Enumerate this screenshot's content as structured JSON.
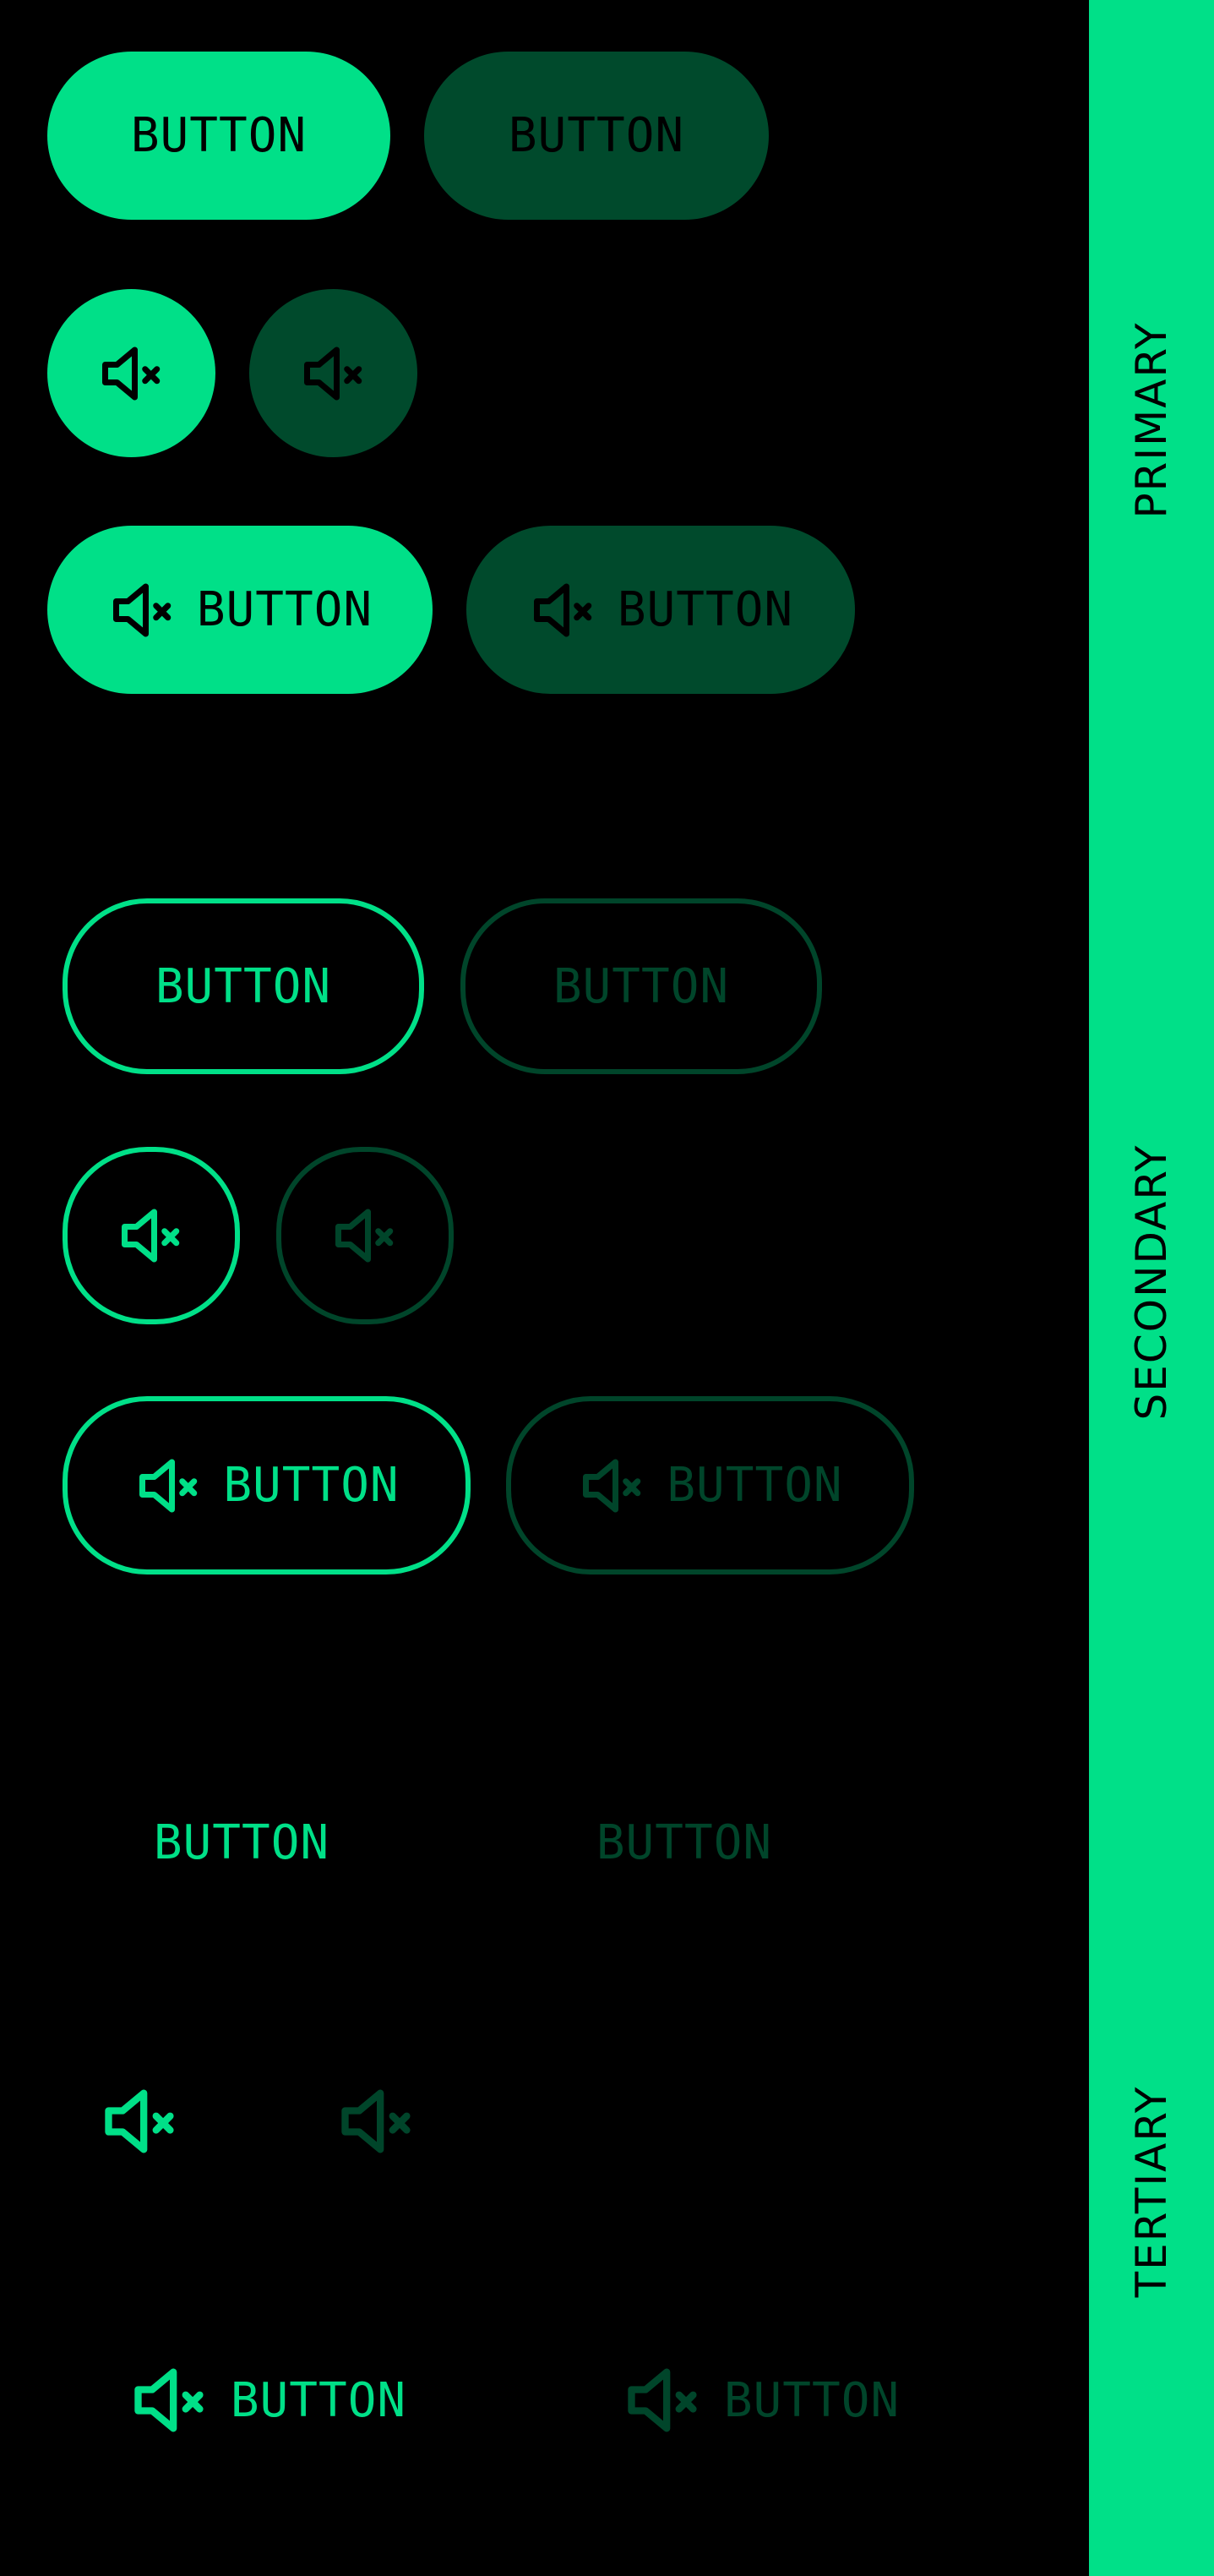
{
  "colors": {
    "background": "#000000",
    "accent": "#00E088",
    "accent_dim": "#004A2C",
    "outline_dim": "#00452A",
    "sidebar_text": "#000000"
  },
  "sections": {
    "primary": {
      "label": "PRIMARY",
      "text_buttons": [
        "BUTTON",
        "BUTTON"
      ],
      "icon": "speaker-muted-icon",
      "icon_text_buttons": [
        "BUTTON",
        "BUTTON"
      ]
    },
    "secondary": {
      "label": "SECONDARY",
      "text_buttons": [
        "BUTTON",
        "BUTTON"
      ],
      "icon": "speaker-muted-icon",
      "icon_text_buttons": [
        "BUTTON",
        "BUTTON"
      ]
    },
    "tertiary": {
      "label": "TERTIARY",
      "text_buttons": [
        "BUTTON",
        "BUTTON"
      ],
      "icon": "speaker-muted-icon",
      "icon_text_buttons": [
        "BUTTON",
        "BUTTON"
      ]
    }
  }
}
